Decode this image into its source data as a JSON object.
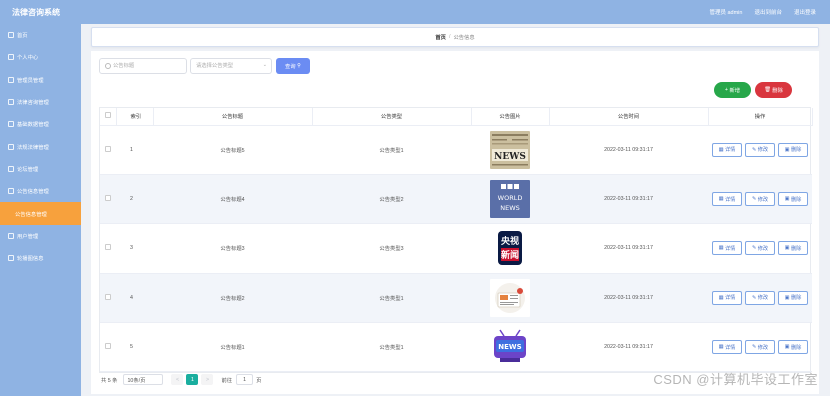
{
  "app": {
    "title": "法律咨询系统"
  },
  "topbar": {
    "user": "管理员 admin",
    "to_front": "退出到前台",
    "logout": "退出登录"
  },
  "sidebar": {
    "items": [
      {
        "label": "首页",
        "sub": false
      },
      {
        "label": "个人中心",
        "sub": false
      },
      {
        "label": "管理员管理",
        "sub": false
      },
      {
        "label": "法律咨询管理",
        "sub": false
      },
      {
        "label": "基础数据管理",
        "sub": false
      },
      {
        "label": "法规法律管理",
        "sub": false
      },
      {
        "label": "论坛管理",
        "sub": false
      },
      {
        "label": "公告信息管理",
        "sub": false
      },
      {
        "label": "公告信息管理",
        "sub": true,
        "active": true
      },
      {
        "label": "用户管理",
        "sub": false
      },
      {
        "label": "轮播图信息",
        "sub": false
      }
    ]
  },
  "breadcrumb": {
    "home": "首页",
    "separator": "/",
    "current": "公告信息"
  },
  "search": {
    "title_placeholder": "公告标题",
    "type_placeholder": "请选择公告类型",
    "button": "查询"
  },
  "actions": {
    "add": "新增",
    "delete": "删除"
  },
  "table": {
    "headers": {
      "index": "索引",
      "title": "公告标题",
      "type": "公告类型",
      "image": "公告图片",
      "time": "公告时间",
      "ops": "操作"
    },
    "ops": {
      "detail": "详情",
      "edit": "修改",
      "delete": "删除"
    },
    "rows": [
      {
        "index": "1",
        "title": "公告标题5",
        "type": "公告类型1",
        "time": "2022-03-11 09:31:17",
        "image": "news-newspaper-image"
      },
      {
        "index": "2",
        "title": "公告标题4",
        "type": "公告类型2",
        "time": "2022-03-11 09:31:17",
        "image": "bbc-world-news-logo-image"
      },
      {
        "index": "3",
        "title": "公告标题3",
        "type": "公告类型3",
        "time": "2022-03-11 09:31:17",
        "image": "cctv-news-logo-image"
      },
      {
        "index": "4",
        "title": "公告标题2",
        "type": "公告类型1",
        "time": "2022-03-11 09:31:17",
        "image": "newspaper-illustration-image"
      },
      {
        "index": "5",
        "title": "公告标题1",
        "type": "公告类型1",
        "time": "2022-03-11 09:31:17",
        "image": "news-tv-icon-image"
      }
    ]
  },
  "pagination": {
    "total": "共 5 条",
    "page_size": "10条/页",
    "prev": "<",
    "current": "1",
    "next": ">",
    "goto": "前往",
    "goto_value": "1",
    "unit": "页"
  },
  "watermark": "CSDN @计算机毕设工作室",
  "colors": {
    "sidebar": "#8fb3e3",
    "active": "#f7a13d",
    "primary": "#6b8cf3",
    "success": "#27a74a",
    "danger": "#d9363e",
    "page_active": "#1aae9f"
  }
}
